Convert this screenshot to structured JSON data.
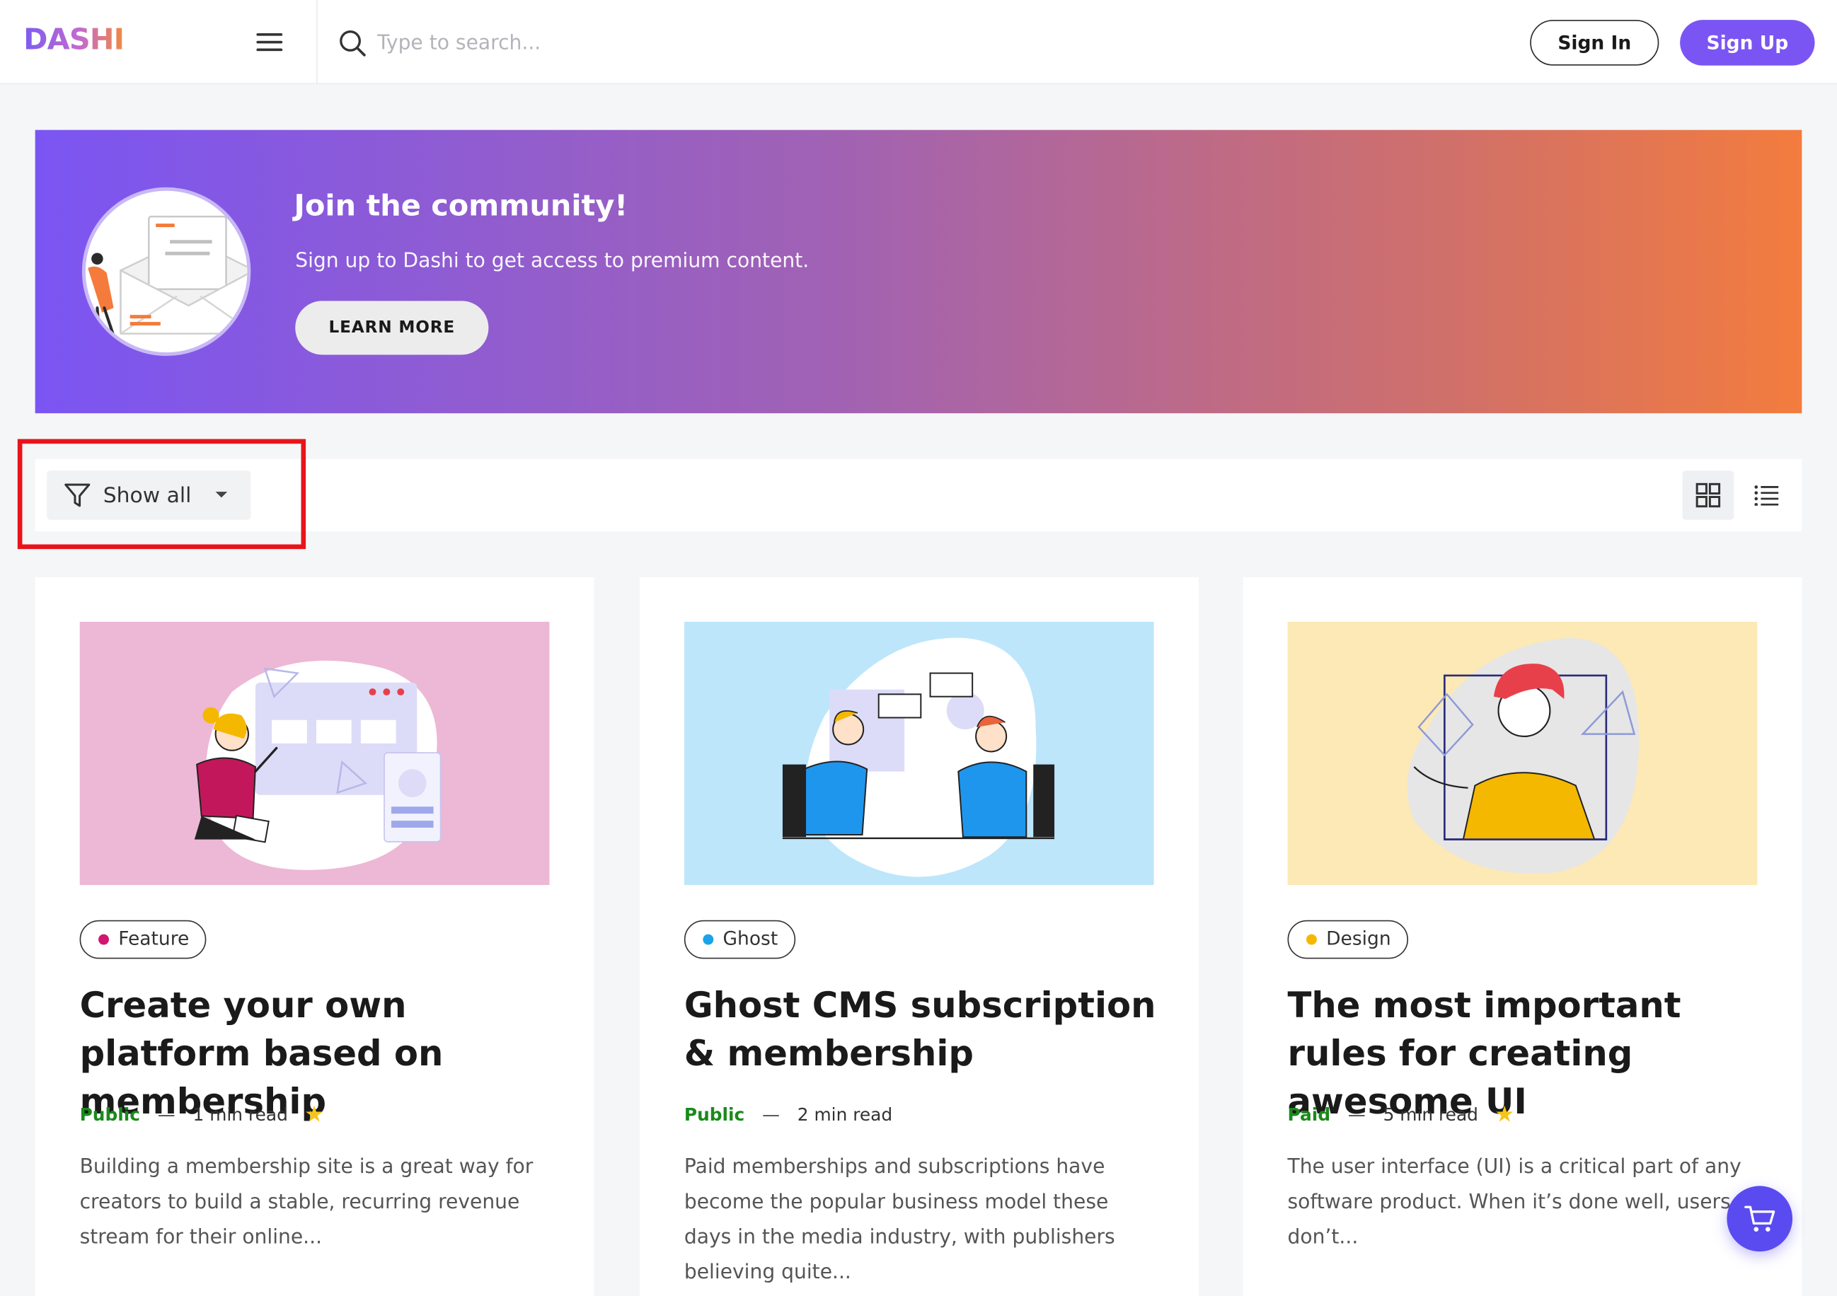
{
  "header": {
    "logo": "DASHI",
    "search_placeholder": "Type to search...",
    "sign_in": "Sign In",
    "sign_up": "Sign Up"
  },
  "banner": {
    "title": "Join the community!",
    "subtitle": "Sign up to Dashi to get access to premium content.",
    "cta": "LEARN MORE"
  },
  "toolbar": {
    "filter_label": "Show all"
  },
  "posts": [
    {
      "tag": "Feature",
      "tag_color": "#d0166f",
      "thumb_bg": "#ecb8d6",
      "title": "Create your own platform based on membership",
      "access": "Public",
      "read_time": "1 min read",
      "featured": true,
      "excerpt": "Building a membership site is a great way for creators to build a stable, recurring revenue stream for their online..."
    },
    {
      "tag": "Ghost",
      "tag_color": "#1aa3e8",
      "thumb_bg": "#bde6fb",
      "title": "Ghost CMS subscription & membership",
      "access": "Public",
      "read_time": "2 min read",
      "featured": false,
      "excerpt": "Paid memberships and subscriptions have become the popular business model these days in the media industry, with publishers believing quite..."
    },
    {
      "tag": "Design",
      "tag_color": "#f5b800",
      "thumb_bg": "#fde9b5",
      "title": "The most important rules for creating awesome UI",
      "access": "Paid",
      "read_time": "5 min read",
      "featured": true,
      "excerpt": "The user interface (UI) is a critical part of any software product. When it’s done well, users don’t..."
    }
  ],
  "colors": {
    "accent": "#7b55f3",
    "highlight_box": "#e8141b",
    "access_text": "#1a8a1a",
    "star": "#f5c518",
    "cart_fab": "#5a4bf0"
  },
  "icons": [
    "menu-icon",
    "search-icon",
    "filter-icon",
    "caret-down-icon",
    "grid-view-icon",
    "list-view-icon",
    "star-icon",
    "cart-icon"
  ]
}
